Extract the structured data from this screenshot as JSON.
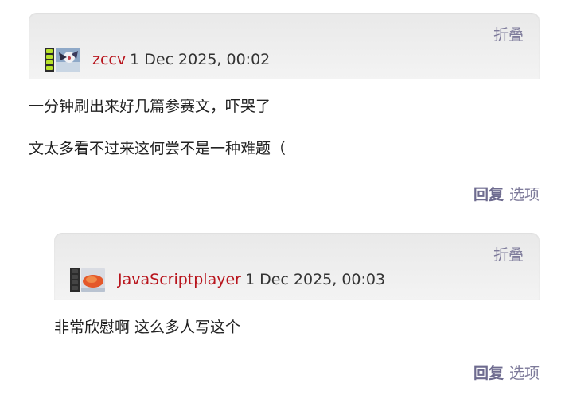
{
  "comments": [
    {
      "fold_label": "折叠",
      "user": "zccv",
      "time": "1 Dec 2025, 00:02",
      "paragraphs": [
        "一分钟刷出来好几篇参赛文，吓哭了",
        "文太多看不过来这何尝不是一种难题（"
      ],
      "reply_label": "回复",
      "options_label": "选项",
      "level_bars_lit": 3
    },
    {
      "fold_label": "折叠",
      "user": "JavaScriptplayer",
      "time": "1 Dec 2025, 00:03",
      "paragraphs": [
        "非常欣慰啊 这么多人写这个"
      ],
      "reply_label": "回复",
      "options_label": "选项",
      "level_bars_lit": 0
    }
  ],
  "colors": {
    "username": "#b8141c",
    "link": "#7d7a9a",
    "level_on": "#b8e22a"
  },
  "icons": [
    "user-level-icon",
    "avatar"
  ]
}
